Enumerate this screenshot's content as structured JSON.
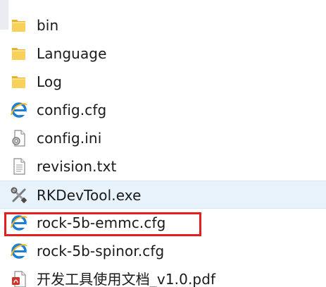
{
  "file_list": {
    "items": [
      {
        "name": "bin",
        "icon": "folder-icon"
      },
      {
        "name": "Language",
        "icon": "folder-icon"
      },
      {
        "name": "Log",
        "icon": "folder-icon"
      },
      {
        "name": "config.cfg",
        "icon": "ie-document-icon"
      },
      {
        "name": "config.ini",
        "icon": "config-settings-icon"
      },
      {
        "name": "revision.txt",
        "icon": "text-file-icon"
      },
      {
        "name": "RKDevTool.exe",
        "icon": "tools-exe-icon"
      },
      {
        "name": "rock-5b-emmc.cfg",
        "icon": "ie-document-icon"
      },
      {
        "name": "rock-5b-spinor.cfg",
        "icon": "ie-document-icon"
      },
      {
        "name": "开发工具使用文档_v1.0.pdf",
        "icon": "pdf-icon"
      }
    ]
  },
  "colors": {
    "highlight_border": "#e3201d",
    "selected_row": "#e8f2fb",
    "folder": "#f5c844"
  }
}
